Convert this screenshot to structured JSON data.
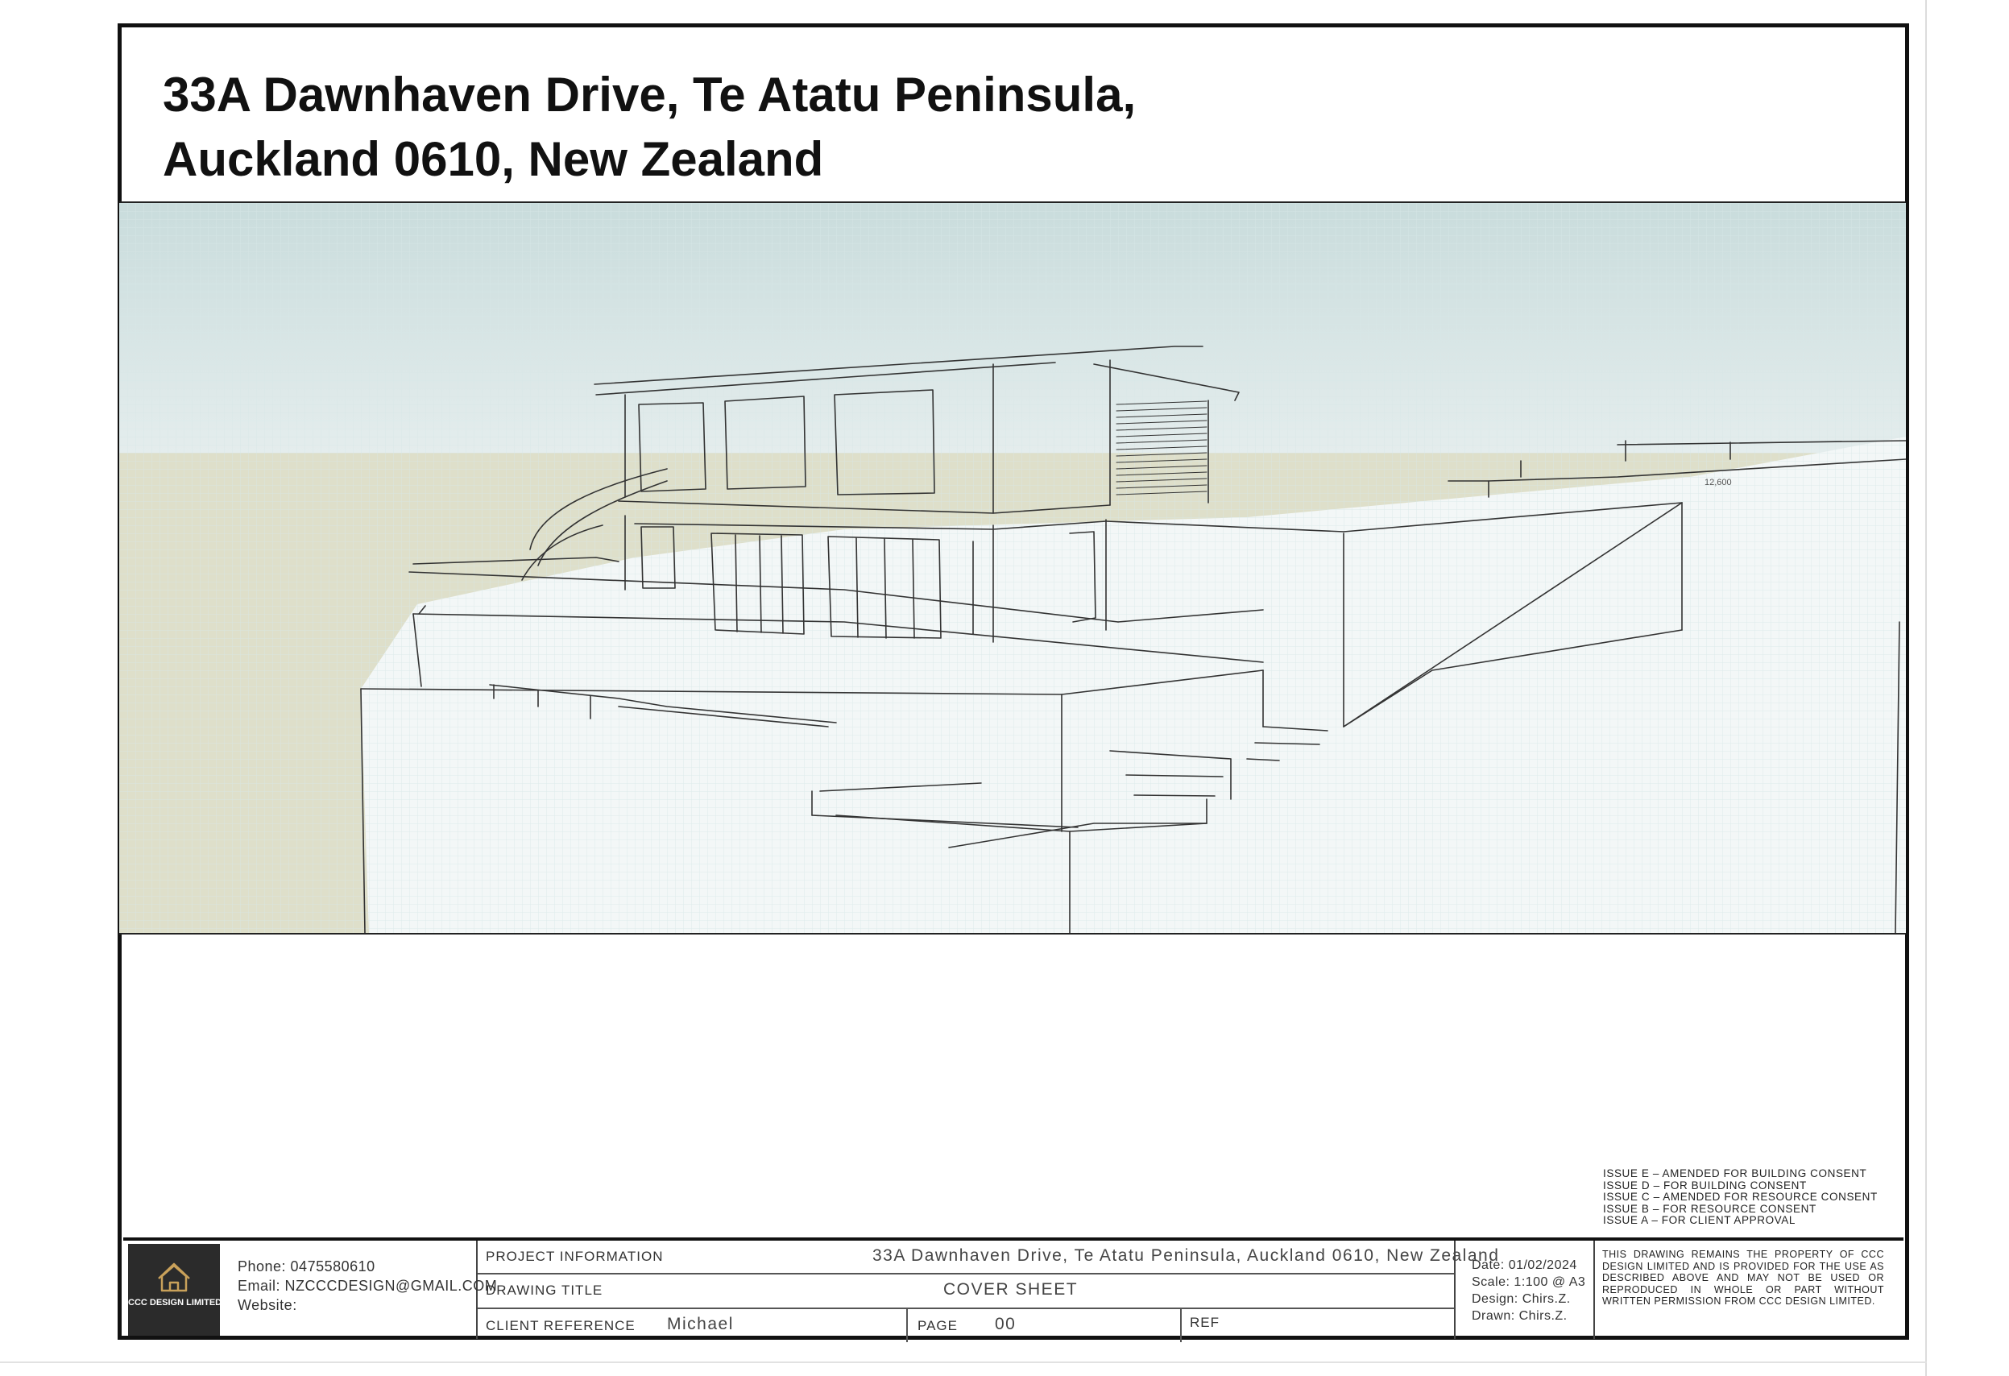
{
  "header": {
    "title_line1": "33A Dawnhaven Drive, Te Atatu Peninsula,",
    "title_line2": "Auckland 0610, New Zealand"
  },
  "render": {
    "dimension_label": "12,600",
    "colors": {
      "sky": "#cfe0e0",
      "ground": "#dcdcc6",
      "paper": "#f4f8f8",
      "grid": "#d5e6e6",
      "sketch": "#333333"
    }
  },
  "issues": [
    "ISSUE E – AMENDED FOR BUILDING CONSENT",
    "ISSUE D – FOR BUILDING CONSENT",
    "ISSUE C – AMENDED FOR RESOURCE CONSENT",
    "ISSUE B – FOR RESOURCE CONSENT",
    "ISSUE A – FOR CLIENT APPROVAL"
  ],
  "title_block": {
    "logo_text": "CCC DESIGN LIMITED",
    "logo_icon": "house-icon",
    "phone": "Phone:  0475580610",
    "email": "Email:  NZCCCDESIGN@GMAIL.COM",
    "website": "Website:",
    "project_info_label": "PROJECT INFORMATION",
    "project_info_value": "33A Dawnhaven Drive, Te Atatu Peninsula, Auckland 0610, New Zealand",
    "drawing_title_label": "DRAWING TITLE",
    "drawing_title_value": "COVER SHEET",
    "client_reference_label": "CLIENT REFERENCE",
    "client_reference_value": "Michael",
    "page_label": "PAGE",
    "page_value": "00",
    "ref_label": "REF",
    "date": "Date:  01/02/2024",
    "scale": "Scale:  1:100 @ A3",
    "design": "Design:  Chirs.Z.",
    "drawn": "Drawn:  Chirs.Z.",
    "notice": "THIS DRAWING REMAINS THE PROPERTY OF CCC DESIGN LIMITED AND IS PROVIDED FOR THE USE AS DESCRIBED ABOVE AND MAY NOT BE USED OR REPRODUCED IN WHOLE OR PART WITHOUT WRITTEN PERMISSION FROM CCC DESIGN LIMITED."
  }
}
